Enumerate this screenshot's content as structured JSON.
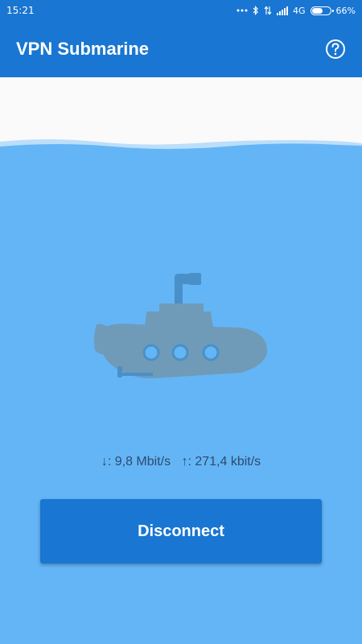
{
  "status_bar": {
    "time": "15:21",
    "network": "4G",
    "battery_percent": "66%",
    "battery_level": 0.66,
    "icons": [
      "dots-icon",
      "bluetooth-icon",
      "data-transfer-icon",
      "signal-icon",
      "battery-icon"
    ]
  },
  "app_bar": {
    "title": "VPN Submarine",
    "help_icon": "help-circle-icon"
  },
  "main": {
    "illustration": "submarine-icon",
    "download_label": "↓: 9,8 Mbit/s",
    "upload_label": "↑: 271,4 kbit/s",
    "disconnect_label": "Disconnect"
  },
  "colors": {
    "primary": "#1976d2",
    "water": "#64b5f6",
    "sky": "#fafafa",
    "submarine_body": "#6f9bb8",
    "porthole": "#64b5f6"
  }
}
